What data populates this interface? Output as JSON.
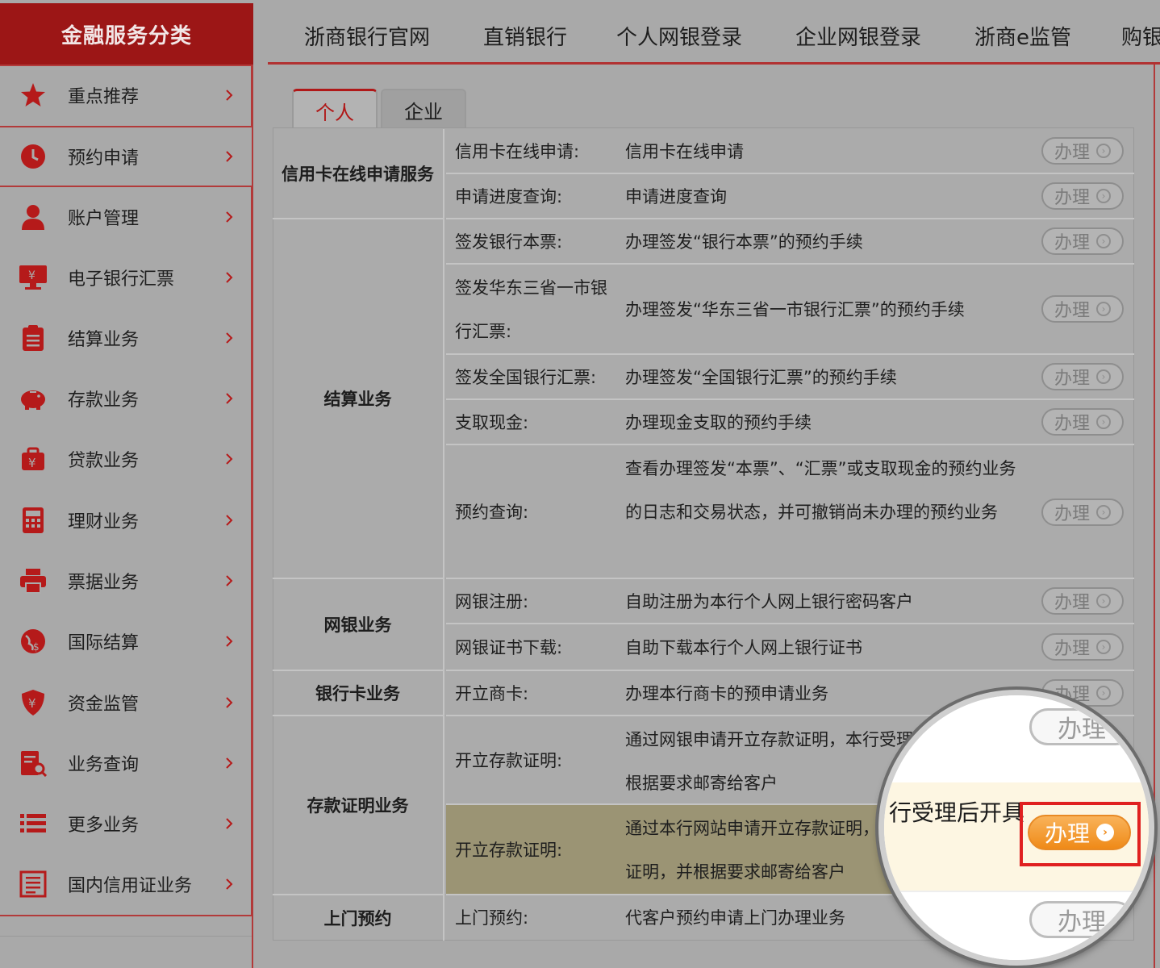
{
  "sidebar": {
    "title": "金融服务分类",
    "items": [
      {
        "label": "重点推荐",
        "icon": "star-icon"
      },
      {
        "label": "预约申请",
        "icon": "clock-icon"
      },
      {
        "label": "账户管理",
        "icon": "user-icon"
      },
      {
        "label": "电子银行汇票",
        "icon": "monitor-yen-icon"
      },
      {
        "label": "结算业务",
        "icon": "clipboard-icon"
      },
      {
        "label": "存款业务",
        "icon": "piggy-bank-icon"
      },
      {
        "label": "贷款业务",
        "icon": "money-bag-icon"
      },
      {
        "label": "理财业务",
        "icon": "calculator-icon"
      },
      {
        "label": "票据业务",
        "icon": "printer-icon"
      },
      {
        "label": "国际结算",
        "icon": "globe-icon"
      },
      {
        "label": "资金监管",
        "icon": "shield-yen-icon"
      },
      {
        "label": "业务查询",
        "icon": "document-search-icon"
      },
      {
        "label": "更多业务",
        "icon": "list-icon"
      },
      {
        "label": "国内信用证业务",
        "icon": "credit-letter-icon"
      }
    ]
  },
  "topnav": {
    "items": [
      "浙商银行官网",
      "直销银行",
      "个人网银登录",
      "企业网银登录",
      "浙商e监管",
      "购银"
    ]
  },
  "tabs": {
    "personal": "个人",
    "business": "企业"
  },
  "table": {
    "button_label": "办理",
    "categories": {
      "credit": "信用卡在线申请服务",
      "settlement": "结算业务",
      "ebank": "网银业务",
      "card": "银行卡业务",
      "deposit": "存款证明业务",
      "visit": "上门预约"
    },
    "rows": [
      {
        "label": "信用卡在线申请:",
        "desc": "信用卡在线申请"
      },
      {
        "label": "申请进度查询:",
        "desc": "申请进度查询"
      },
      {
        "label": "签发银行本票:",
        "desc": "办理签发“银行本票”的预约手续"
      },
      {
        "label": "签发华东三省一市银行汇票:",
        "desc": "办理签发“华东三省一市银行汇票”的预约手续"
      },
      {
        "label": "签发全国银行汇票:",
        "desc": "办理签发“全国银行汇票”的预约手续"
      },
      {
        "label": "支取现金:",
        "desc": "办理现金支取的预约手续"
      },
      {
        "label": "预约查询:",
        "desc": "查看办理签发“本票”、“汇票”或支取现金的预约业务的日志和交易状态，并可撤销尚未办理的预约业务"
      },
      {
        "label": "网银注册:",
        "desc": "自助注册为本行个人网上银行密码客户"
      },
      {
        "label": "网银证书下载:",
        "desc": "自助下载本行个人网上银行证书"
      },
      {
        "label": "开立商卡:",
        "desc": "办理本行商卡的预申请业务"
      },
      {
        "label": "开立存款证明:",
        "desc": "通过网银申请开立存款证明，本行受理后开具证明，并根据要求邮寄给客户"
      },
      {
        "label": "开立存款证明:",
        "desc": "通过本行网站申请开立存款证明，本行受理后开具存款证明，并根据要求邮寄给客户"
      },
      {
        "label": "上门预约:",
        "desc": "代客户预约申请上门办理业务"
      }
    ]
  },
  "magnifier": {
    "text_fragment": "行受理后开具",
    "button_label": "办理",
    "accent": "#ef8a18",
    "frame_color": "#e02020"
  }
}
